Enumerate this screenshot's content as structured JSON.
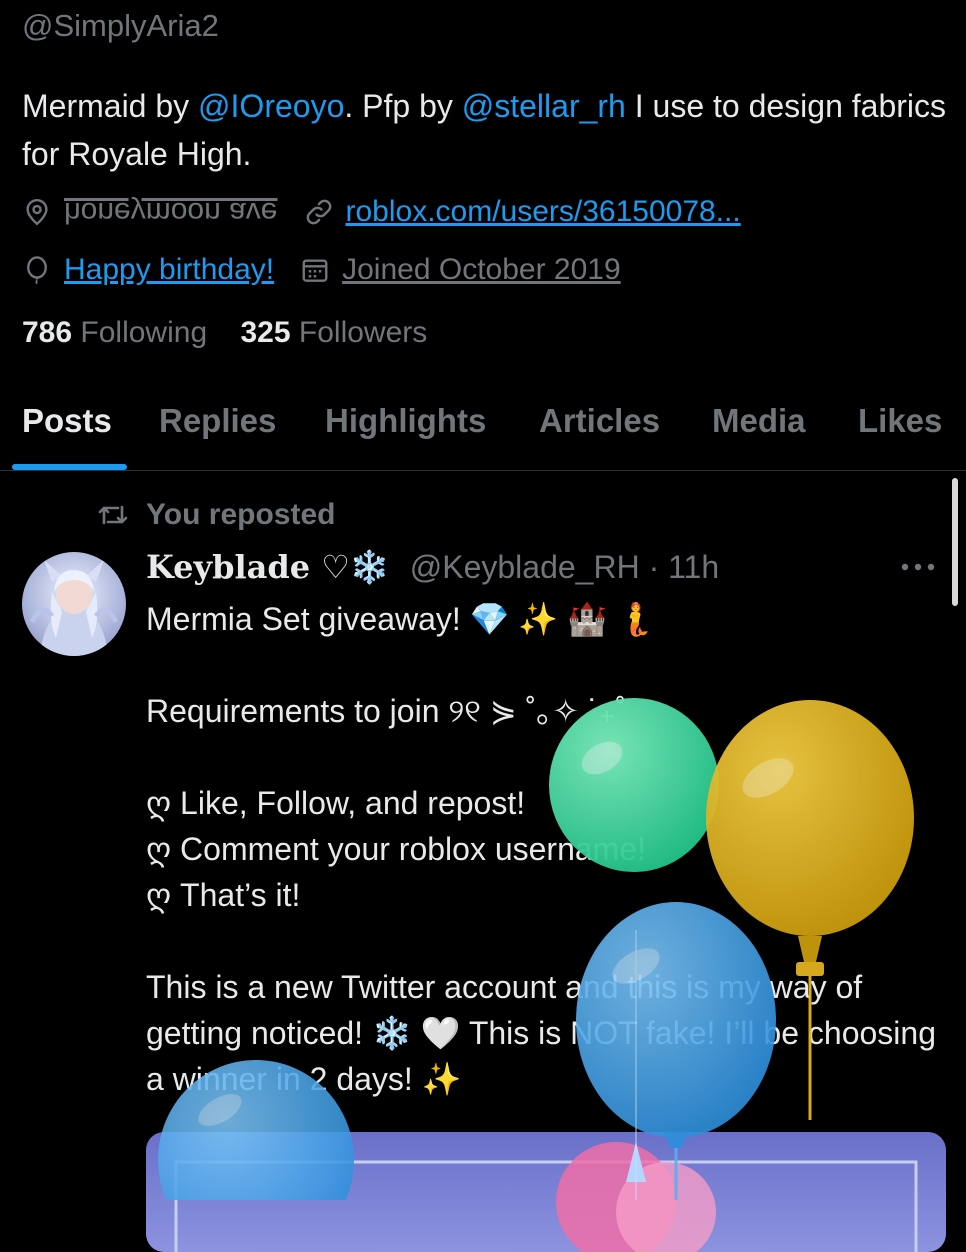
{
  "profile": {
    "handle": "@SimplyAria2",
    "bio": {
      "part1": "Mermaid by ",
      "mention1": "@IOreoyo",
      "part2": ". Pfp by ",
      "mention2": "@stellar_rh",
      "part3": " I use to design fabrics for Royale High."
    },
    "location": "honeymoon ave",
    "website": "roblox.com/users/36150078...",
    "birthday": "Happy birthday!",
    "joined": "Joined October 2019",
    "following_count": "786",
    "following_label": "Following",
    "followers_count": "325",
    "followers_label": "Followers"
  },
  "tabs": [
    {
      "label": "Posts",
      "active": true
    },
    {
      "label": "Replies"
    },
    {
      "label": "Highlights"
    },
    {
      "label": "Articles"
    },
    {
      "label": "Media"
    },
    {
      "label": "Likes"
    }
  ],
  "post": {
    "repost_label": "You reposted",
    "author_name": "Keyblade ♡❄️",
    "author_handle": "@Keyblade_RH · 11h",
    "text": "Mermia Set giveaway! 💎 ✨ 🏰 🧜\n\nRequirements to join ୨୧ ⋟ ˚｡✧ ˙₊˚\n\n ღ Like, Follow, and repost!\n ღ Comment your roblox username!\n ღ That’s it!\n\nThis is a new Twitter account and this is my way of getting noticed! ❄️ 🤍 This is NOT fake! I’ll be choosing a winner in 2 days! ✨"
  },
  "colors": {
    "accent": "#1d9bf0",
    "muted": "#71767b",
    "text": "#e7e9ea",
    "background": "#000000",
    "balloon_green": "#34d399",
    "balloon_yellow": "#e0b422",
    "balloon_blue": "#4aa3e8"
  },
  "icons": [
    "location-icon",
    "link-icon",
    "balloon-icon",
    "calendar-icon",
    "repost-icon",
    "more-icon"
  ]
}
